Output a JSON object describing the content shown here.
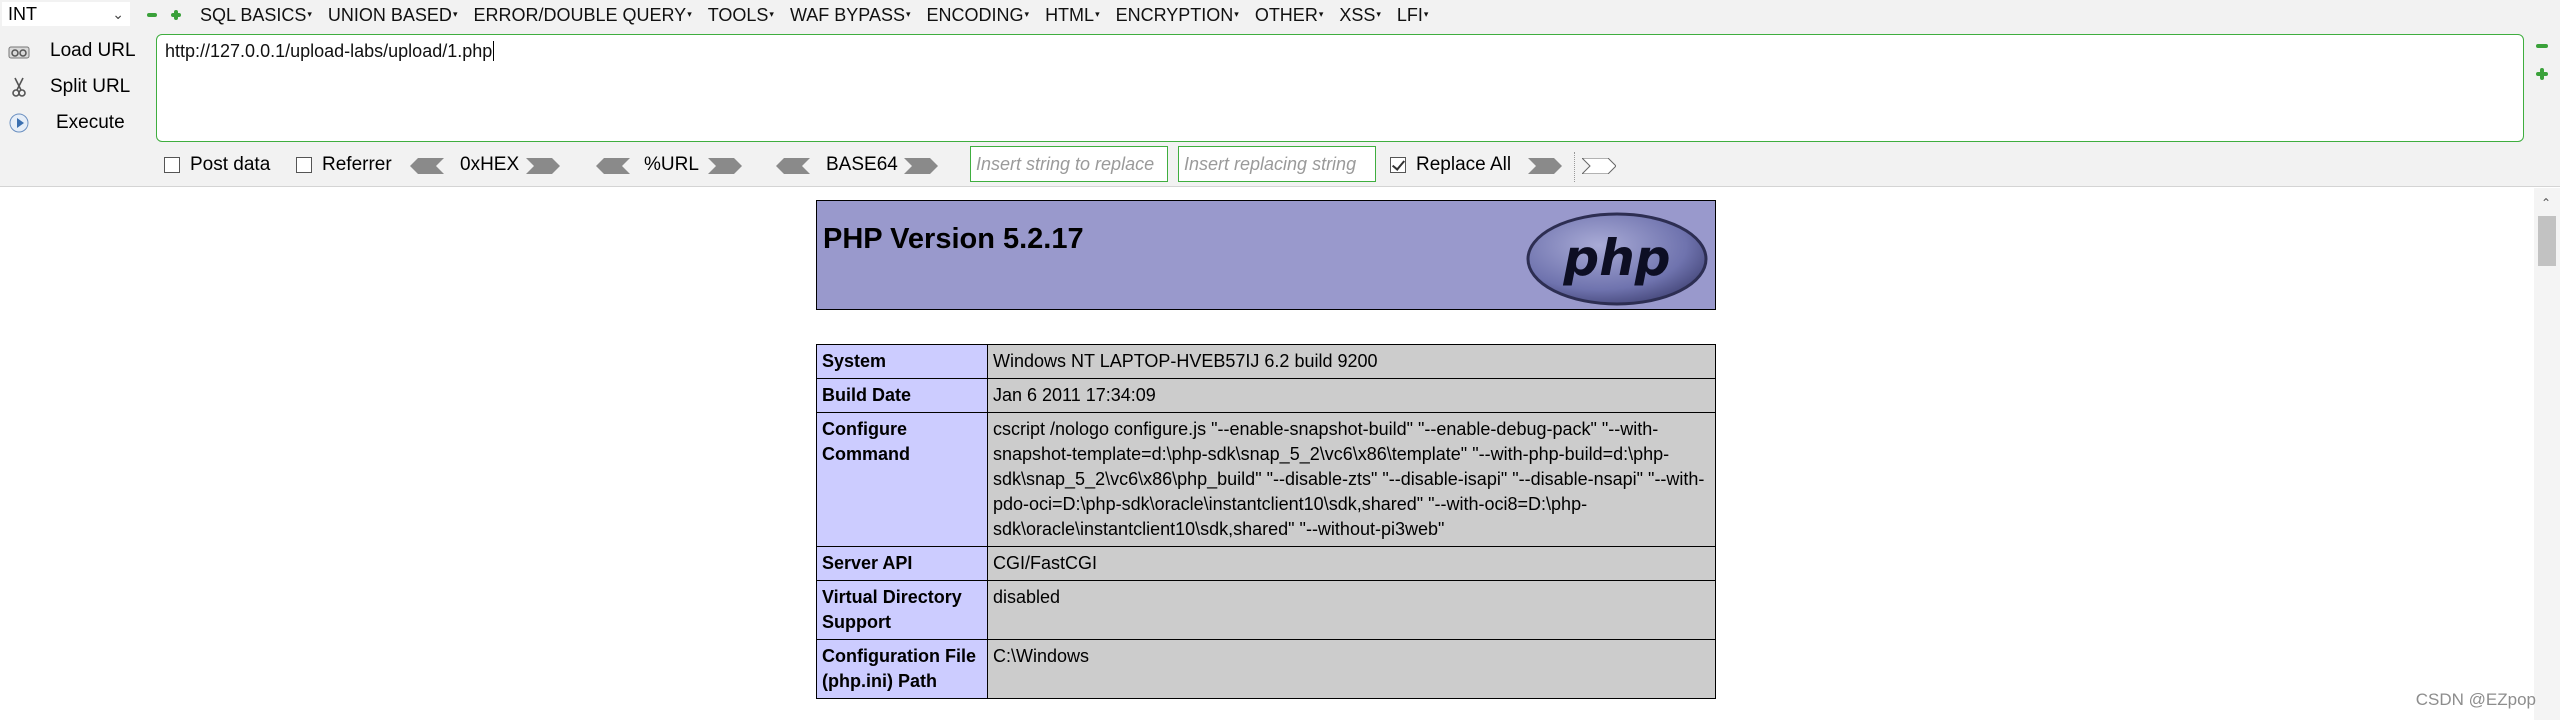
{
  "hackbar": {
    "type_select": "INT",
    "menu": [
      "SQL BASICS",
      "UNION BASED",
      "ERROR/DOUBLE QUERY",
      "TOOLS",
      "WAF BYPASS",
      "ENCODING",
      "HTML",
      "ENCRYPTION",
      "OTHER",
      "XSS",
      "LFI"
    ],
    "actions": {
      "load": "Load URL",
      "split": "Split URL",
      "execute": "Execute"
    },
    "url": "http://127.0.0.1/upload-labs/upload/1.php",
    "options": {
      "post_data": {
        "label": "Post data",
        "checked": false
      },
      "referrer": {
        "label": "Referrer",
        "checked": false
      },
      "hex": "0xHEX",
      "url_enc": "%URL",
      "base64": "BASE64",
      "replace_from_placeholder": "Insert string to replace",
      "replace_to_placeholder": "Insert replacing string",
      "replace_all": {
        "label": "Replace All",
        "checked": true
      }
    },
    "accent_color": "#3fae3f"
  },
  "phpinfo": {
    "title": "PHP Version 5.2.17",
    "logo_text": "php",
    "rows": [
      {
        "key": "System",
        "value": "Windows NT LAPTOP-HVEB57IJ 6.2 build 9200"
      },
      {
        "key": "Build Date",
        "value": "Jan 6 2011 17:34:09"
      },
      {
        "key": "Configure Command",
        "value": "cscript /nologo configure.js \"--enable-snapshot-build\" \"--enable-debug-pack\" \"--with-snapshot-template=d:\\php-sdk\\snap_5_2\\vc6\\x86\\template\" \"--with-php-build=d:\\php-sdk\\snap_5_2\\vc6\\x86\\php_build\" \"--disable-zts\" \"--disable-isapi\" \"--disable-nsapi\" \"--with-pdo-oci=D:\\php-sdk\\oracle\\instantclient10\\sdk,shared\" \"--with-oci8=D:\\php-sdk\\oracle\\instantclient10\\sdk,shared\" \"--without-pi3web\""
      },
      {
        "key": "Server API",
        "value": "CGI/FastCGI"
      },
      {
        "key": "Virtual Directory Support",
        "value": "disabled"
      },
      {
        "key": "Configuration File (php.ini) Path",
        "value": "C:\\Windows"
      }
    ],
    "header_color": "#9999cc",
    "key_color": "#ccccff",
    "value_color": "#cccccc"
  },
  "watermark": "CSDN @EZpop"
}
